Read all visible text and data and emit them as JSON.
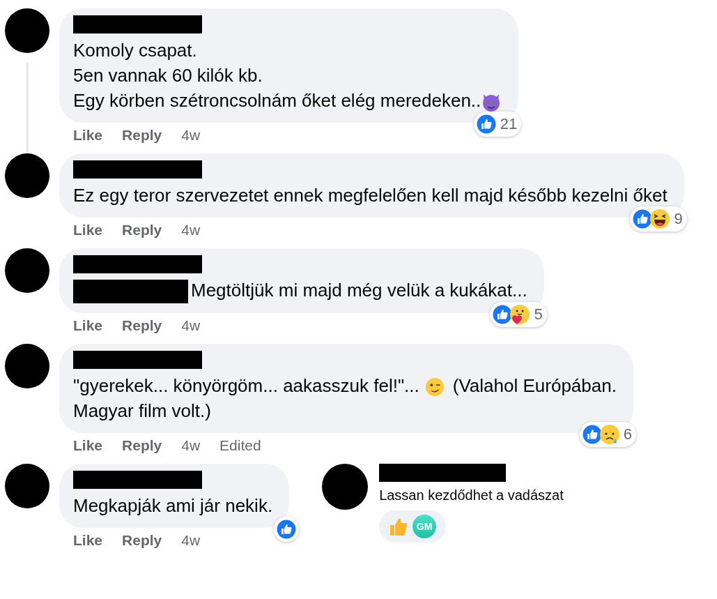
{
  "comments": [
    {
      "paragraphs": [
        [
          {
            "kind": "text",
            "text": "Komoly csapat."
          }
        ],
        [
          {
            "kind": "text",
            "text": "5en vannak 60 kilók kb."
          }
        ],
        [
          {
            "kind": "text",
            "text": "Egy körben szétroncsolnám őket elég meredeken.."
          },
          {
            "kind": "devil-emoji"
          }
        ]
      ],
      "reactions": [
        {
          "kind": "like"
        }
      ],
      "count": "21",
      "actions": [
        "Like",
        "Reply",
        "4w"
      ],
      "thread_line": true
    },
    {
      "paragraphs": [
        [
          {
            "kind": "text",
            "text": "Ez egy teror szervezetet ennek megfelelően kell majd később kezelni őket"
          }
        ]
      ],
      "reactions": [
        {
          "kind": "like"
        },
        {
          "kind": "laugh"
        }
      ],
      "count": "9",
      "actions": [
        "Like",
        "Reply",
        "4w"
      ],
      "thread_line": false
    },
    {
      "paragraphs": [
        [
          {
            "kind": "redaction"
          },
          {
            "kind": "text",
            "text": "Megtöltjük mi majd még velük a kukákat..."
          }
        ]
      ],
      "reactions": [
        {
          "kind": "like"
        },
        {
          "kind": "care"
        }
      ],
      "count": "5",
      "actions": [
        "Like",
        "Reply",
        "4w"
      ],
      "thread_line": false
    },
    {
      "paragraphs": [
        [
          {
            "kind": "text",
            "text": "\"gyerekek... könyörgöm... aakasszuk fel!\"..."
          },
          {
            "kind": "wink-emoji"
          },
          {
            "kind": "text",
            "text": "(Valahol Európában."
          }
        ],
        [
          {
            "kind": "text",
            "text": "Magyar film volt.)"
          }
        ]
      ],
      "reactions": [
        {
          "kind": "like"
        },
        {
          "kind": "sad"
        }
      ],
      "count": "6",
      "actions": [
        "Like",
        "Reply",
        "4w",
        "Edited"
      ],
      "thread_line": false
    }
  ],
  "last_comment": {
    "paragraphs": [
      [
        {
          "kind": "text",
          "text": "Megkapják ami jár nekik."
        }
      ]
    ],
    "reactions": [
      {
        "kind": "like"
      }
    ],
    "actions": [
      "Like",
      "Reply",
      "4w"
    ]
  },
  "side_comment": {
    "text": "Lassan kezdődhet a vadászat",
    "reaction_avatar": "GM"
  }
}
